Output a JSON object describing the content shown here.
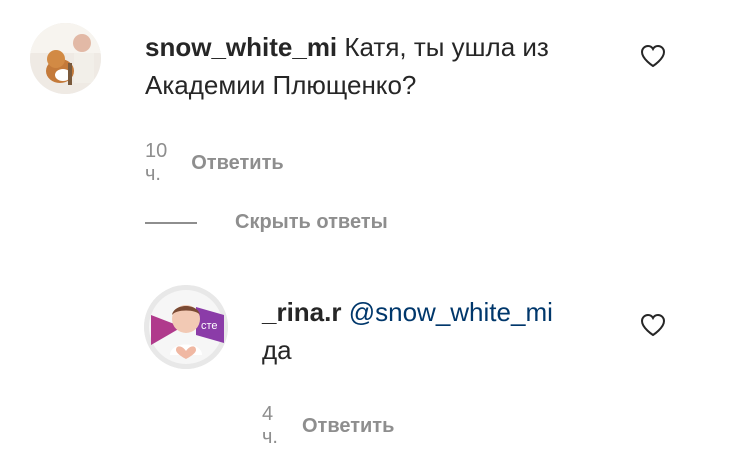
{
  "comments": [
    {
      "username": "snow_white_mi",
      "text_line1": "Катя, ты ушла из",
      "text_line2": "Академии Плющенко?",
      "time": "10 ч.",
      "reply_label": "Ответить",
      "avatar_icon": "cat-photo-avatar"
    }
  ],
  "replies_toggle": {
    "label": "Скрыть ответы"
  },
  "replies": [
    {
      "username": "_rina.r",
      "mention": "@snow_white_mi",
      "text": "да",
      "time": "4 ч.",
      "reply_label": "Ответить",
      "avatar_icon": "girl-heart-hands-avatar",
      "avatar_ring_color": "#e8e8e8"
    }
  ],
  "colors": {
    "text": "#262626",
    "secondary": "#8e8e8e",
    "mention": "#00376b"
  },
  "icons": {
    "like": "heart-outline-icon"
  }
}
